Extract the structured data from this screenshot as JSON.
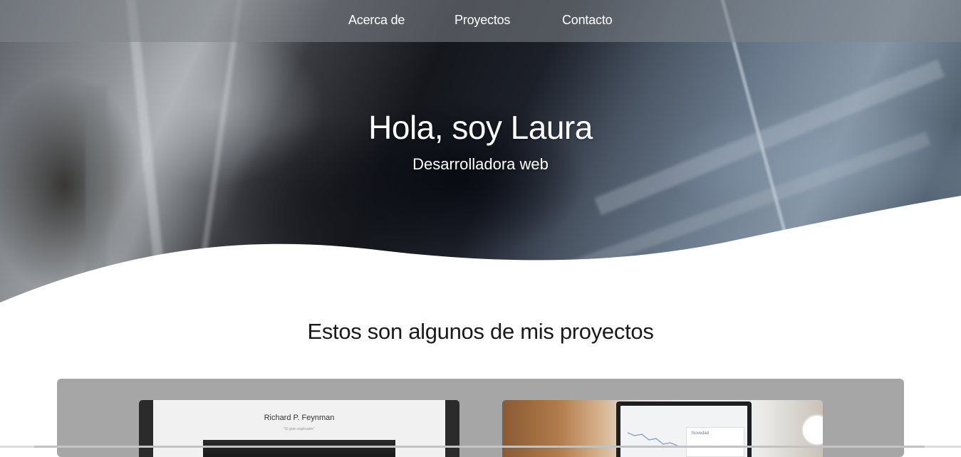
{
  "nav": {
    "items": [
      {
        "label": "Acerca de"
      },
      {
        "label": "Proyectos"
      },
      {
        "label": "Contacto"
      }
    ]
  },
  "hero": {
    "title": "Hola, soy Laura",
    "subtitle": "Desarrolladora web"
  },
  "projects": {
    "heading": "Estos son algunos de mis proyectos",
    "cards": [
      {
        "preview_title": "Richard P. Feynman",
        "preview_subtitle": "\"El gran explicador\""
      },
      {
        "preview_label": "Novedad"
      }
    ]
  },
  "colors": {
    "nav_background": "#82868c",
    "projects_panel": "#a6a6a6",
    "text_light": "#ffffff",
    "text_dark": "#1a1a1a"
  }
}
